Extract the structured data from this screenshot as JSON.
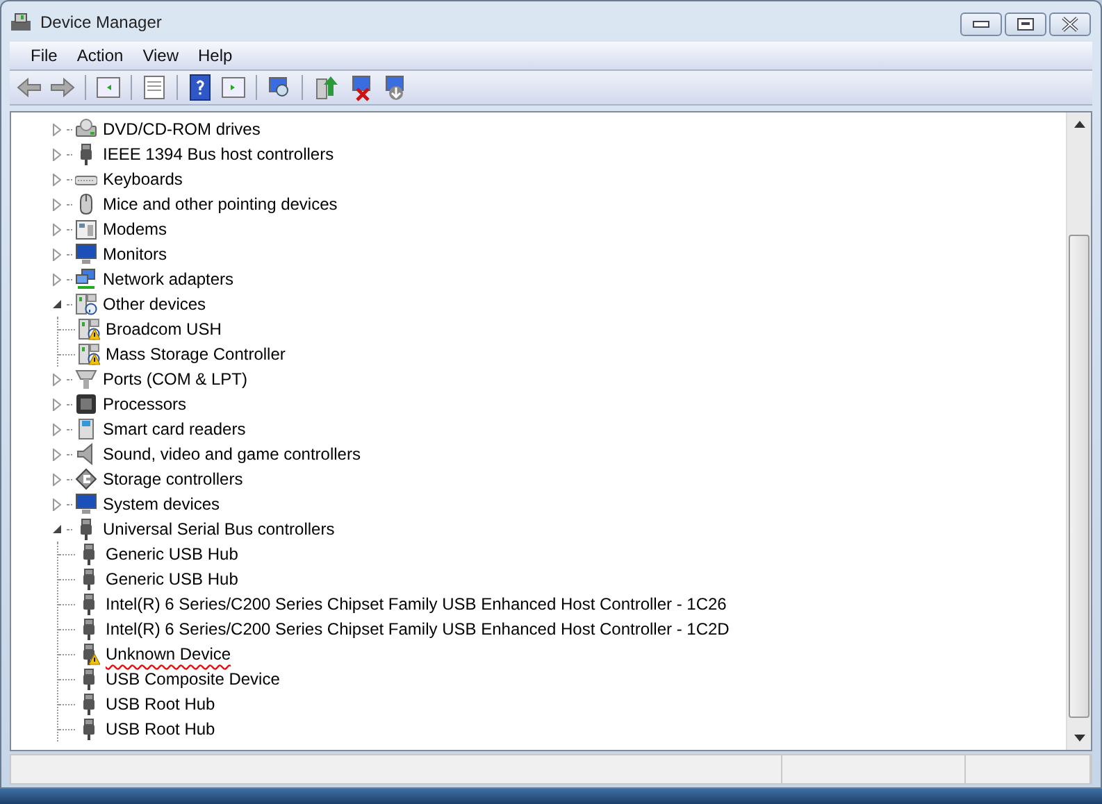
{
  "window": {
    "title": "Device Manager"
  },
  "menu": [
    "File",
    "Action",
    "View",
    "Help"
  ],
  "tree": [
    {
      "label": "DVD/CD-ROM drives",
      "kind": "drive",
      "expanded": false
    },
    {
      "label": "IEEE 1394 Bus host controllers",
      "kind": "plug",
      "expanded": false
    },
    {
      "label": "Keyboards",
      "kind": "keyboard",
      "expanded": false
    },
    {
      "label": "Mice and other pointing devices",
      "kind": "mouse",
      "expanded": false
    },
    {
      "label": "Modems",
      "kind": "modem",
      "expanded": false
    },
    {
      "label": "Monitors",
      "kind": "monitor",
      "expanded": false
    },
    {
      "label": "Network adapters",
      "kind": "network",
      "expanded": false
    },
    {
      "label": "Other devices",
      "kind": "unknown",
      "expanded": true,
      "children": [
        {
          "label": "Broadcom USH",
          "kind": "unknown",
          "warning": true,
          "underlined": false
        },
        {
          "label": "Mass Storage Controller",
          "kind": "unknown",
          "warning": true,
          "underlined": false
        }
      ]
    },
    {
      "label": "Ports (COM & LPT)",
      "kind": "port",
      "expanded": false
    },
    {
      "label": "Processors",
      "kind": "chip",
      "expanded": false
    },
    {
      "label": "Smart card readers",
      "kind": "card",
      "expanded": false
    },
    {
      "label": "Sound, video and game controllers",
      "kind": "speaker",
      "expanded": false
    },
    {
      "label": "Storage controllers",
      "kind": "storage",
      "expanded": false
    },
    {
      "label": "System devices",
      "kind": "monitor",
      "expanded": false
    },
    {
      "label": "Universal Serial Bus controllers",
      "kind": "plug",
      "expanded": true,
      "children": [
        {
          "label": "Generic USB Hub",
          "kind": "plug",
          "warning": false,
          "underlined": false
        },
        {
          "label": "Generic USB Hub",
          "kind": "plug",
          "warning": false,
          "underlined": false
        },
        {
          "label": "Intel(R) 6 Series/C200 Series Chipset Family USB Enhanced Host Controller - 1C26",
          "kind": "plug",
          "warning": false,
          "underlined": false
        },
        {
          "label": "Intel(R) 6 Series/C200 Series Chipset Family USB Enhanced Host Controller - 1C2D",
          "kind": "plug",
          "warning": false,
          "underlined": false
        },
        {
          "label": "Unknown Device",
          "kind": "plug",
          "warning": true,
          "underlined": true
        },
        {
          "label": "USB Composite Device",
          "kind": "plug",
          "warning": false,
          "underlined": false
        },
        {
          "label": "USB Root Hub",
          "kind": "plug",
          "warning": false,
          "underlined": false
        },
        {
          "label": "USB Root Hub",
          "kind": "plug",
          "warning": false,
          "underlined": false
        }
      ]
    }
  ]
}
